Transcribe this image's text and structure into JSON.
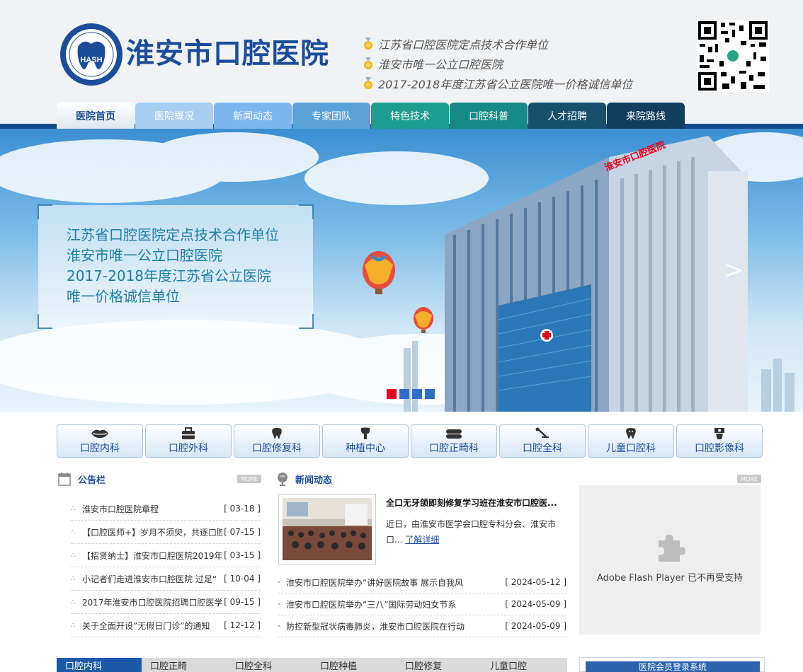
{
  "header": {
    "title": "淮安市口腔医院",
    "logo_abbr": "HASH",
    "logo_ring_text": "淮安市口腔医院",
    "logo_ring_en": "Huaian Stomatological Hospital",
    "slogans": [
      "江苏省口腔医院定点技术合作单位",
      "淮安市唯一公立口腔医院",
      "2017-2018年度江苏省公立医院唯一价格诚信单位"
    ]
  },
  "nav": {
    "items": [
      {
        "label": "医院首页",
        "color": "#ffffff"
      },
      {
        "label": "医院概况",
        "color": "#a7cdf1"
      },
      {
        "label": "新闻动态",
        "color": "#7db6ec"
      },
      {
        "label": "专家团队",
        "color": "#5aa2d8"
      },
      {
        "label": "特色技术",
        "color": "#1d9d8f"
      },
      {
        "label": "口腔科普",
        "color": "#168a86"
      },
      {
        "label": "人才招聘",
        "color": "#17506f"
      },
      {
        "label": "来院路线",
        "color": "#113f5e"
      }
    ]
  },
  "banner": {
    "lines": [
      "江苏省口腔医院定点技术合作单位",
      "淮安市唯一公立口腔医院",
      "2017-2018年度江苏省公立医院",
      "唯一价格诚信单位"
    ],
    "building_sign": "淮安市口腔医院",
    "next_label": ">"
  },
  "departments": [
    {
      "label": "口腔内科",
      "icon": "lips-icon"
    },
    {
      "label": "口腔外科",
      "icon": "medical-kit-icon"
    },
    {
      "label": "口腔修复科",
      "icon": "tooth-icon"
    },
    {
      "label": "种植中心",
      "icon": "implant-icon"
    },
    {
      "label": "口腔正畸科",
      "icon": "braces-icon"
    },
    {
      "label": "口腔全科",
      "icon": "dental-tools-icon"
    },
    {
      "label": "儿童口腔科",
      "icon": "child-tooth-icon"
    },
    {
      "label": "口腔影像科",
      "icon": "xray-icon"
    }
  ],
  "notices": {
    "title": "公告栏",
    "more": "MORE",
    "items": [
      {
        "text": "淮安市口腔医院章程",
        "date": "[ 03-18 ]"
      },
      {
        "text": "【口腔医师+】岁月不须臾，共逐口腔",
        "date": "[ 07-15 ]"
      },
      {
        "text": "【招贤纳士】淮安市口腔医院2019年",
        "date": "[ 03-15 ]"
      },
      {
        "text": "小记者们走进淮安市口腔医院 过足“",
        "date": "[ 10-04 ]"
      },
      {
        "text": "2017年淮安市口腔医院招聘口腔医学",
        "date": "[ 09-15 ]"
      },
      {
        "text": "关于全面开设”无假日门诊”的通知",
        "date": "[ 12-12 ]"
      }
    ]
  },
  "news": {
    "title": "新闻动态",
    "more": "MORE",
    "headline": "全口无牙颌即刻修复学习班在淮安市口腔医...",
    "summary": "近日，由淮安市医学会口腔专科分会、淮安市口...",
    "read_more": "了解详细",
    "items": [
      {
        "text": "淮安市口腔医院举办“讲好医院故事 展示自我风",
        "date": "[ 2024-05-12 ]"
      },
      {
        "text": "淮安市口腔医院举办“三八”国际劳动妇女节系",
        "date": "[ 2024-05-09 ]"
      },
      {
        "text": "防控新型冠状病毒肺炎，淮安市口腔医院在行动",
        "date": "[ 2024-05-09 ]"
      }
    ]
  },
  "flash": {
    "message": "Adobe Flash Player 已不再受支持"
  },
  "bottom_tabs": [
    "口腔内科",
    "口腔正畸",
    "口腔全科",
    "口腔种植",
    "口腔修复",
    "儿童口腔"
  ],
  "login": {
    "title": "医院会员登录系统"
  },
  "colors": {
    "brand": "#1b4d9b",
    "nav_bar": "#134a8e",
    "active_dot": "#e8001c"
  }
}
